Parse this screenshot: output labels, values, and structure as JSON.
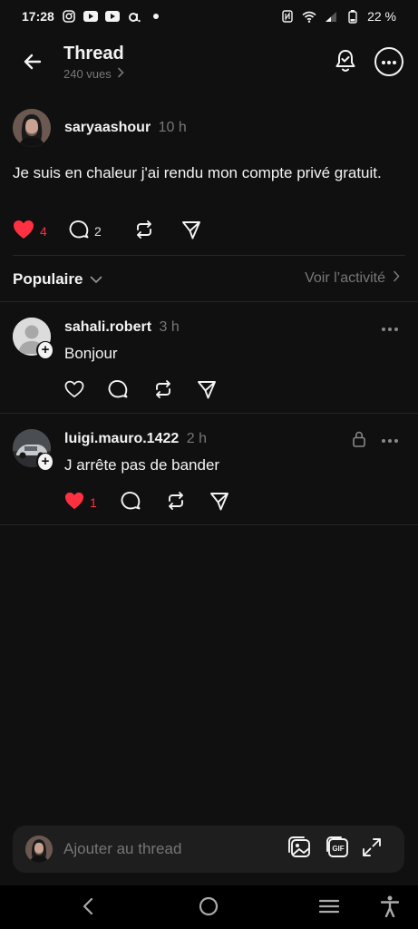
{
  "status_bar": {
    "time": "17:28",
    "battery": "22 %"
  },
  "header": {
    "title": "Thread",
    "views": "240 vues"
  },
  "post": {
    "username": "saryaashour",
    "time": "10 h",
    "text": "Je suis en chaleur j'ai rendu mon compte privé gratuit.",
    "likes": "4",
    "comments": "2"
  },
  "sort": {
    "label": "Populaire",
    "activity_link": "Voir l’activité"
  },
  "replies": [
    {
      "username": "sahali.robert",
      "time": "3 h",
      "text": "Bonjour",
      "likes": ""
    },
    {
      "username": "luigi.mauro.1422",
      "time": "2 h",
      "text": "J arrête pas de bander",
      "likes": "1"
    }
  ],
  "composer": {
    "placeholder": "Ajouter au thread"
  },
  "colors": {
    "background": "#101010",
    "like_red": "#ff3040",
    "muted": "#777777"
  }
}
